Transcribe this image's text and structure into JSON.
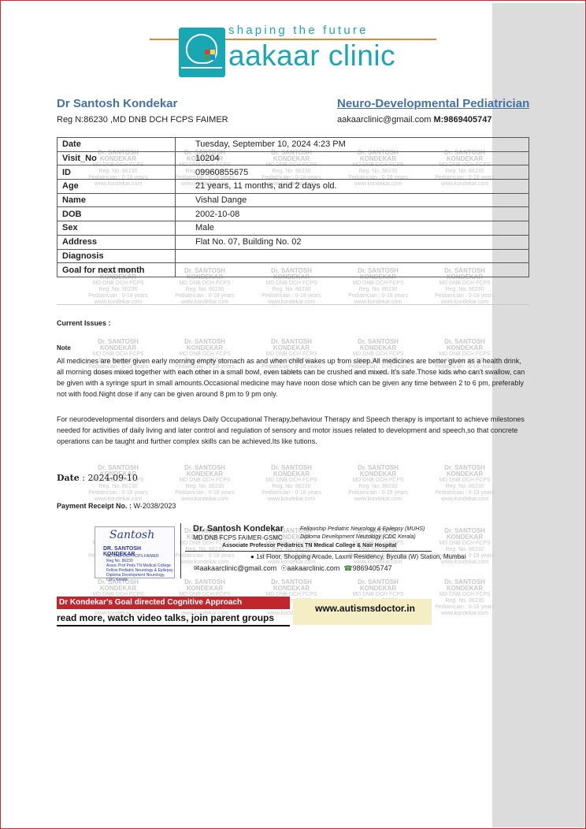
{
  "clinic": {
    "tagline": "shaping the future",
    "name": "aakaar clinic",
    "colors": {
      "brand": "#1aa7b4",
      "accent_line": "#e0882e",
      "doctor_blue": "#4472a4"
    }
  },
  "doctor": {
    "name": "Dr Santosh Kondekar",
    "reg": "Reg N:86230 ,MD DNB DCH FCPS FAIMER",
    "specialty": "Neuro-Developmental Pediatrician",
    "email": "aakaarclinic@gmail.com",
    "mobile_label": "M:",
    "mobile": "9869405747"
  },
  "patient_table": {
    "rows": [
      {
        "label": "Date",
        "value": "Tuesday, September 10, 2024 4:23 PM"
      },
      {
        "label": "Visit_No",
        "value": "10204"
      },
      {
        "label": "ID",
        "value": "09960855675"
      },
      {
        "label": "Age",
        "value": "21 years, 11 months, and 2 days old."
      },
      {
        "label": "Name",
        "value": "Vishal Dange"
      },
      {
        "label": "DOB",
        "value": "2002-10-08"
      },
      {
        "label": "Sex",
        "value": "Male"
      },
      {
        "label": "Address",
        "value": "Flat No. 07, Building No. 02"
      },
      {
        "label": "Diagnosis",
        "value": ""
      },
      {
        "label": "Goal for next month",
        "value": ""
      }
    ]
  },
  "notes": {
    "current_issues_label": "Current Issues :",
    "note_label": "Note",
    "note_para1": "All medicines are better given early morning empty stomach as and when child wakes up from sleep.All medicines are better given as a health drink, all morning doses mixed together with each other in a small bowl, even tablets can be crushed and mixed. It's safe.Those kids who can't swallow, can be given with a syringe spurt in small amounts.Occasional medicine may have noon dose which can be given any time between 2 to 6 pm, preferably not with food.Night dose if any can be given around 8 pm to 9 pm only.",
    "note_para2": "For neurodevelopmental disorders and delays Daily Occupational Therapy,behaviour Therapy and Speech therapy is important to achieve milestones needed for activities of daily living and later control and regulation of sensory and motor issues related to development and speech,so that concrete operations can be taught and further complex skills can be achieved.Its like tutions."
  },
  "signoff": {
    "date_label": "Date",
    "date_value": ": 2024-09-10",
    "receipt_label": "Payment Receipt No. :",
    "receipt_value": "W-2038/2023"
  },
  "card": {
    "stamp_sign": "Santosh",
    "stamp_name": "DR. SANTOSH KONDEKAR",
    "stamp_sub": [
      "MD DNB DCH FCPS FAIMER",
      "Reg No. 86230",
      "Assoc Prof Peds TN Medical College",
      "Fellow Pediatric Neurology & Epilepsy",
      "Diploma Development Neurology, CDC Kerala"
    ],
    "name": "Dr. Santosh Kondekar",
    "degrees": "MD DNB FCPS FAIMER-GSMC",
    "fellowship1": "Fellowship Pediatric Neurology & Epilepsy (MUHS)",
    "fellowship2": "Diploma Development Neurology (CDC Kerala)",
    "professor": "Associate Professor Pediatrics TN Medical College & Nair Hospital",
    "address": "1st Floor, Shopping Arcade, Laxmi Residency, Byculla (W) Station, Mumbai",
    "email": "aakaarclinic@gmail.com",
    "website_small": "aakaarclinic.com",
    "phone": "9869405747"
  },
  "banner": {
    "goal": "Dr Kondekar's Goal directed Cognitive Approach",
    "sub": "read more, watch video talks, join parent groups",
    "website": "www.autismsdoctor.in"
  },
  "watermark": {
    "name": "Dr. SANTOSH KONDEKAR",
    "degrees": "MD DNB DCH FCPS",
    "reg": "Reg. No. 86230",
    "ages": "Pediatrician : 0-18 years",
    "site": "www.kondekar.com"
  }
}
